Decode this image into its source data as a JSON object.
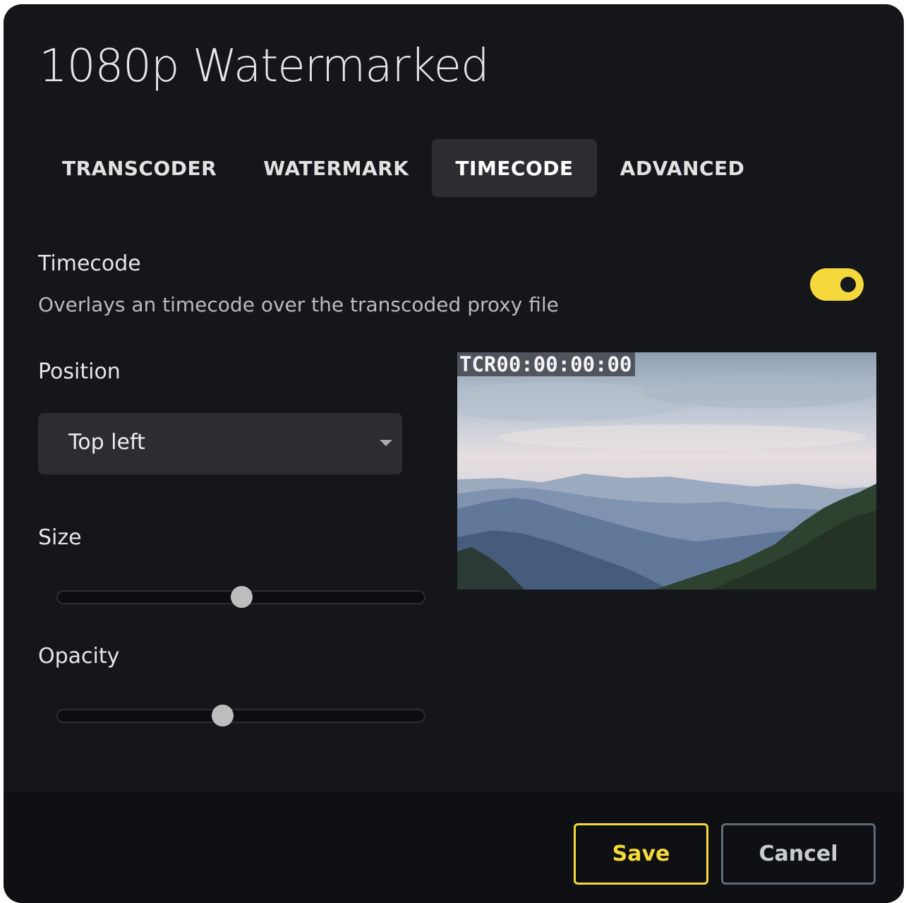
{
  "dialog": {
    "title": "1080p Watermarked"
  },
  "tabs": [
    {
      "label": "TRANSCODER",
      "active": false
    },
    {
      "label": "WATERMARK",
      "active": false
    },
    {
      "label": "TIMECODE",
      "active": true
    },
    {
      "label": "ADVANCED",
      "active": false
    }
  ],
  "timecode": {
    "label": "Timecode",
    "description": "Overlays an timecode over the transcoded proxy file",
    "enabled": true
  },
  "position": {
    "label": "Position",
    "selected": "Top left"
  },
  "size": {
    "label": "Size",
    "value_fraction": 0.5
  },
  "opacity": {
    "label": "Opacity",
    "value_fraction": 0.45
  },
  "preview": {
    "overlay_text": "TCR00:00:00:00"
  },
  "footer": {
    "save_label": "Save",
    "cancel_label": "Cancel"
  },
  "colors": {
    "accent": "#f5d83b",
    "background": "#14161a",
    "footer": "#0f1013",
    "control": "#2b2d32"
  },
  "icons": {
    "select_caret": "caret-down-icon"
  }
}
